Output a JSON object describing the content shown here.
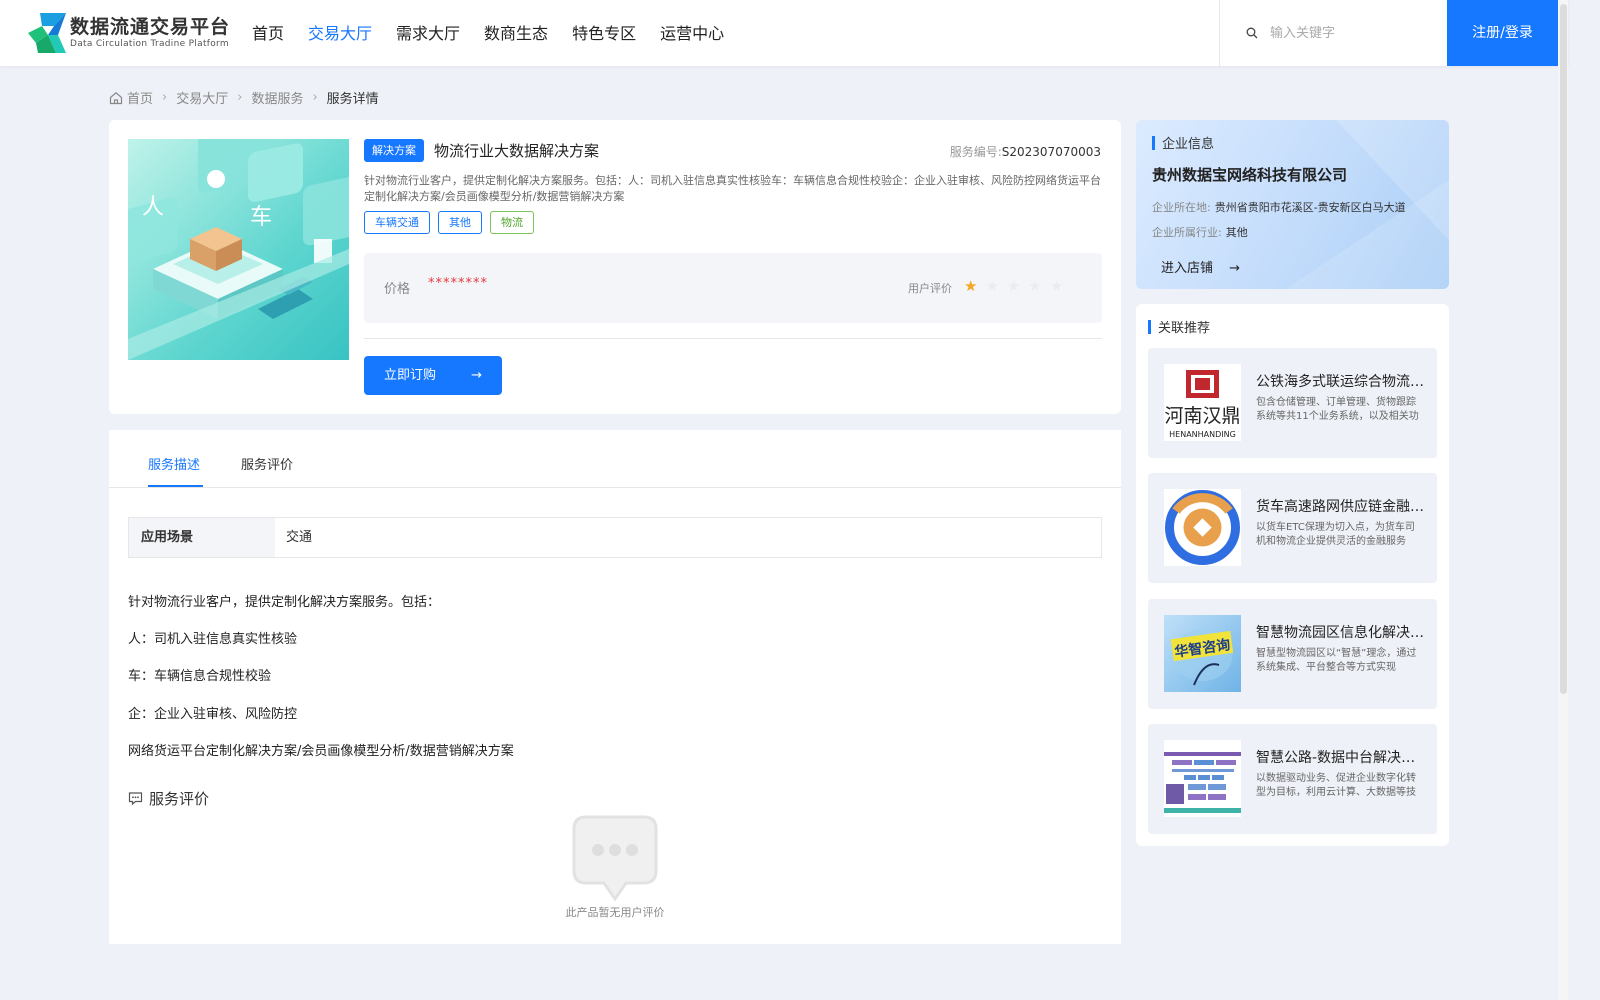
{
  "header": {
    "logo_cn": "数据流通交易平台",
    "logo_en": "Data Circulation Tradine Platform",
    "nav": [
      "首页",
      "交易大厅",
      "需求大厅",
      "数商生态",
      "特色专区",
      "运营中心"
    ],
    "active_nav": "交易大厅",
    "search_placeholder": "输入关键字",
    "login_label": "注册/登录"
  },
  "breadcrumb": {
    "items": [
      "首页",
      "交易大厅",
      "数据服务"
    ],
    "current": "服务详情"
  },
  "product": {
    "badge": "解决方案",
    "title": "物流行业大数据解决方案",
    "service_no_label": "服务编号:",
    "service_no": "S202307070003",
    "description": "针对物流行业客户，提供定制化解决方案服务。包括：人：司机入驻信息真实性核验车：车辆信息合规性校验企：企业入驻审核、风险防控网络货运平台定制化解决方案/会员画像模型分析/数据营销解决方案",
    "tags": [
      "车辆交通",
      "其他",
      "物流"
    ],
    "price_label": "价格",
    "price_value": "********",
    "rating_label": "用户评价",
    "rating": 1,
    "rating_max": 5,
    "buy_label": "立即订购"
  },
  "tabs": [
    "服务描述",
    "服务评价"
  ],
  "active_tab": "服务描述",
  "detail": {
    "scene_label": "应用场景",
    "scene_value": "交通",
    "paragraphs": [
      "针对物流行业客户，提供定制化解决方案服务。包括：",
      "人：司机入驻信息真实性核验",
      "车：车辆信息合规性校验",
      "企：企业入驻审核、风险防控",
      "网络货运平台定制化解决方案/会员画像模型分析/数据营销解决方案"
    ]
  },
  "reviews": {
    "title": "服务评价",
    "empty_text": "此产品暂无用户评价"
  },
  "company": {
    "section_title": "企业信息",
    "name": "贵州数据宝网络科技有限公司",
    "location_label": "企业所在地:",
    "location": "贵州省贵阳市花溪区-贵安新区白马大道",
    "industry_label": "企业所属行业:",
    "industry": "其他",
    "shop_label": "进入店铺"
  },
  "recommend": {
    "section_title": "关联推荐",
    "items": [
      {
        "title": "公铁海多式联运综合物流服务平台",
        "desc": "包含仓储管理、订单管理、货物跟踪系统等共11个业务系统，以及相关功能模块",
        "thumb_text": "河南汉鼎",
        "thumb_sub": "HENANHANDING"
      },
      {
        "title": "货车高速路网供应链金融服务",
        "desc": "以货车ETC保理为切入点，为货车司机和物流企业提供灵活的金融服务",
        "thumb_text": "",
        "thumb_sub": ""
      },
      {
        "title": "智慧物流园区信息化解决方案",
        "desc": "智慧型物流园区以“智慧”理念，通过系统集成、平台整合等方式实现",
        "thumb_text": "华智咨询",
        "thumb_sub": ""
      },
      {
        "title": "智慧公路-数据中台解决方案",
        "desc": "以数据驱动业务、促进企业数字化转型为目标，利用云计算、大数据等技术",
        "thumb_text": "",
        "thumb_sub": ""
      }
    ]
  },
  "colors": {
    "primary": "#1677ff",
    "price": "#e4393c",
    "star": "#f5a623",
    "tag_green": "#52a62d"
  }
}
